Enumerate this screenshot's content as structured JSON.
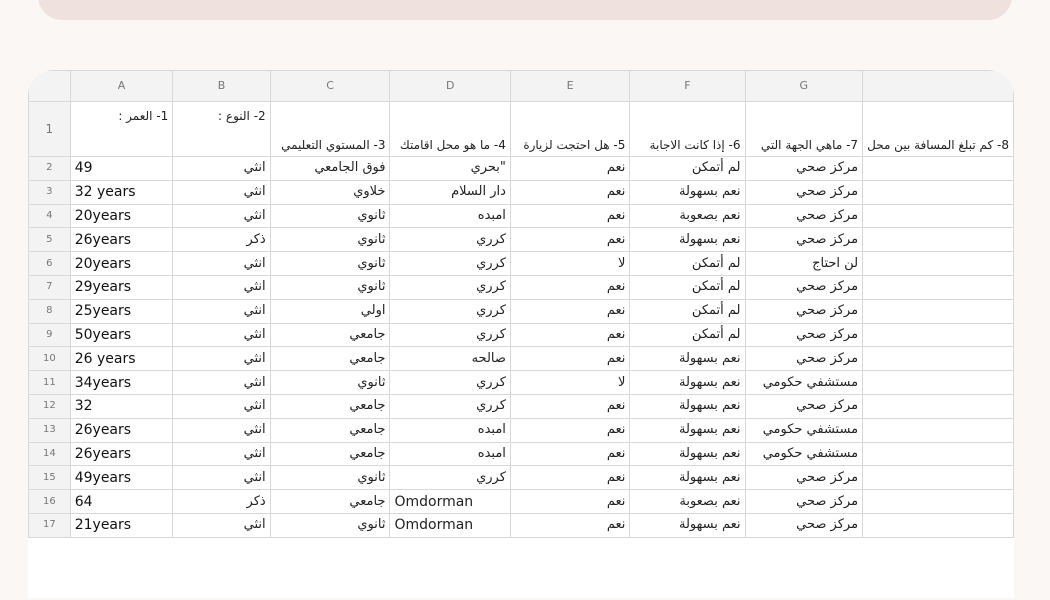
{
  "columns": [
    "A",
    "B",
    "C",
    "D",
    "E",
    "F",
    "G",
    ""
  ],
  "header_row": {
    "num": "1",
    "A": "1- العمر :",
    "B": "2- النوع :",
    "C": "3- المستوي التعليمي",
    "D": "4- ما هو محل اقامتك",
    "E": "5- هل احتجت لزيارة",
    "F": "6- إذا كانت الاجابة",
    "G": "7- ماهي الجهة التي",
    "H": "8- كم تبلغ المسافة بين محل"
  },
  "rows": [
    {
      "num": "2",
      "A": "49",
      "B": "انثي",
      "C": "فوق الجامعي",
      "D": "\"بحري",
      "E": "نعم",
      "F": "لم أتمكن",
      "G": "مركز صحي"
    },
    {
      "num": "3",
      "A": "32 years",
      "B": "انثي",
      "C": "خلاوي",
      "D": "دار السلام",
      "E": "نعم",
      "F": "نعم بسهولة",
      "G": "مركز صحي"
    },
    {
      "num": "4",
      "A": "20years",
      "B": "انثي",
      "C": "ثانوي",
      "D": "امبده",
      "E": "نعم",
      "F": "نعم بصعوبة",
      "G": "مركز صحي"
    },
    {
      "num": "5",
      "A": "26years",
      "B": "ذكر",
      "C": "ثانوي",
      "D": "كرري",
      "E": "نعم",
      "F": "نعم بسهولة",
      "G": "مركز صحي"
    },
    {
      "num": "6",
      "A": "20years",
      "B": "انثي",
      "C": "ثانوي",
      "D": "كرري",
      "E": "لا",
      "F": "لم أتمكن",
      "G": "لن احتاج"
    },
    {
      "num": "7",
      "A": "29years",
      "B": "انثي",
      "C": "ثانوي",
      "D": "كرري",
      "E": "نعم",
      "F": "لم أتمكن",
      "G": "مركز صحي"
    },
    {
      "num": "8",
      "A": "25years",
      "B": "انثي",
      "C": "اولي",
      "D": "كرري",
      "E": "نعم",
      "F": "لم أتمكن",
      "G": "مركز صحي"
    },
    {
      "num": "9",
      "A": "50years",
      "B": "انثي",
      "C": "جامعي",
      "D": "كرري",
      "E": "نعم",
      "F": "لم أتمكن",
      "G": "مركز صحي"
    },
    {
      "num": "10",
      "A": "26 years",
      "B": "انثي",
      "C": "جامعي",
      "D": "صالحه",
      "E": "نعم",
      "F": "نعم بسهولة",
      "G": "مركز صحي"
    },
    {
      "num": "11",
      "A": "34years",
      "B": "انثي",
      "C": "ثانوي",
      "D": "كرري",
      "E": "لا",
      "F": "نعم بسهولة",
      "G": "مستشفي حكومي"
    },
    {
      "num": "12",
      "A": " 32",
      "B": "انثي",
      "C": "جامعي",
      "D": "كرري",
      "E": "نعم",
      "F": "نعم بسهولة",
      "G": "مركز صحي"
    },
    {
      "num": "13",
      "A": "26years",
      "B": "انثي",
      "C": "جامعي",
      "D": "امبده",
      "E": "نعم",
      "F": "نعم بسهولة",
      "G": "مستشفي حكومي"
    },
    {
      "num": "14",
      "A": "26years",
      "B": "انثي",
      "C": "جامعي",
      "D": "امبده",
      "E": "نعم",
      "F": "نعم بسهولة",
      "G": "مستشفي حكومي"
    },
    {
      "num": "15",
      "A": "49years",
      "B": "انثي",
      "C": "ثانوي",
      "D": "كرري",
      "E": "نعم",
      "F": "نعم بسهولة",
      "G": "مركز صحي"
    },
    {
      "num": "16",
      "A": "64",
      "B": "ذكر",
      "C": "جامعي",
      "D": "Omdorman",
      "E": "نعم",
      "F": "نعم بصعوبة",
      "G": "مركز صحي"
    },
    {
      "num": "17",
      "A": "21years",
      "B": "انثي",
      "C": "ثانوي",
      "D": "Omdorman",
      "E": "نعم",
      "F": "نعم بسهولة",
      "G": "مركز صحي"
    }
  ]
}
